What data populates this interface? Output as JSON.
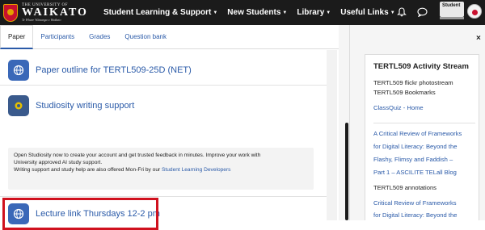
{
  "header": {
    "logo": {
      "small_text": "THE UNIVERSITY OF",
      "main_text": "WAIKATO",
      "motto": "Te Whare Wānanga o Waikato"
    },
    "nav": [
      {
        "label": "Student Learning & Support"
      },
      {
        "label": "New Students"
      },
      {
        "label": "Library"
      },
      {
        "label": "Useful Links"
      }
    ],
    "user_button_label": "Student"
  },
  "tabs": [
    {
      "label": "Paper",
      "active": true
    },
    {
      "label": "Participants"
    },
    {
      "label": "Grades"
    },
    {
      "label": "Question bank"
    }
  ],
  "activities": [
    {
      "label": "Paper outline for TERTL509-25D (NET)",
      "icon": "globe-icon"
    },
    {
      "label": "Studiosity writing support",
      "icon": "studiosity-icon"
    },
    {
      "label": "Lecture link Thursdays 12-2 pm",
      "icon": "globe-icon"
    }
  ],
  "studiosity_description": {
    "line1": "Open Studiosity now to create your account and get trusted feedback in minutes. Improve your work with",
    "line2": "University approved AI study support.",
    "line3_prefix": "Writing support and study help are also offered Mon-Fri by our",
    "line3_link": "Student Learning Developers"
  },
  "drawer": {
    "close_label": "×",
    "block": {
      "title": "TERTL509 Activity Stream",
      "lines": [
        {
          "text": "TERTL509 flickr photostream",
          "kind": "plain"
        },
        {
          "text": "TERTL509 Bookmarks",
          "kind": "plain"
        },
        {
          "text": "ClassQuiz - Home",
          "kind": "link"
        },
        {
          "text": "A Critical Review of Frameworks",
          "kind": "link"
        },
        {
          "text": "for Digital Literacy: Beyond the",
          "kind": "link"
        },
        {
          "text": "Flashy, Flimsy and Faddish –",
          "kind": "link"
        },
        {
          "text": "Part 1 – ASCILITE TELall Blog",
          "kind": "link"
        },
        {
          "text": "TERTL509 annotations",
          "kind": "plain"
        },
        {
          "text": "Critical Review of Frameworks",
          "kind": "link"
        },
        {
          "text": "for Digital Literacy: Beyond the",
          "kind": "link"
        }
      ]
    }
  },
  "colors": {
    "accent": "#2a5aa8",
    "header_bg": "#1b1b1b",
    "highlight": "#d0111e",
    "brand_red": "#c8102e"
  }
}
